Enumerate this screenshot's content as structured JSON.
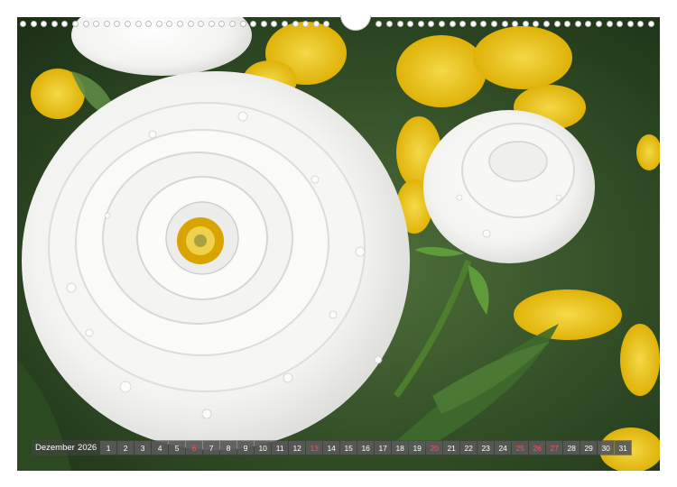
{
  "calendar": {
    "month": "Dezember",
    "year": "2026",
    "days": [
      "1",
      "2",
      "3",
      "4",
      "5",
      "6",
      "7",
      "8",
      "9",
      "10",
      "11",
      "12",
      "13",
      "14",
      "15",
      "16",
      "17",
      "18",
      "19",
      "20",
      "21",
      "22",
      "23",
      "24",
      "25",
      "26",
      "27",
      "28",
      "29",
      "30",
      "31"
    ],
    "highlight_color": "#ff5252"
  },
  "photo": {
    "subject_icon": "white-ranunculus-photo"
  }
}
